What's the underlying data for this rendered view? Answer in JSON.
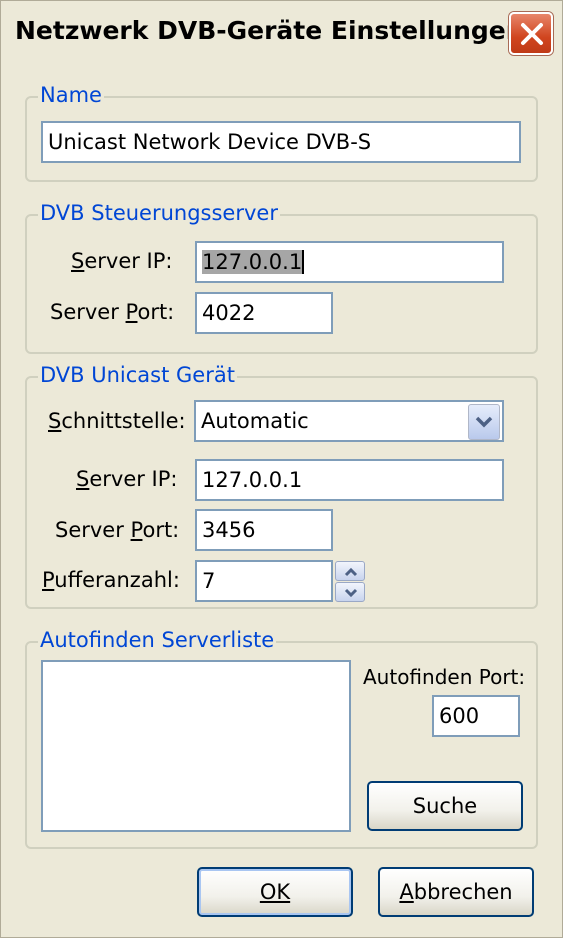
{
  "window": {
    "title": "Netzwerk DVB-Geräte Einstellungen"
  },
  "name_group": {
    "label": "Name",
    "value": "Unicast Network Device DVB-S"
  },
  "control_server": {
    "label": "DVB Steuerungsserver",
    "ip_label": "Server IP:",
    "ip_value": "127.0.0.1",
    "port_label": "Server Port:",
    "port_value": "4022"
  },
  "unicast_device": {
    "label": "DVB Unicast Gerät",
    "interface_label": "Schnittstelle:",
    "interface_value": "Automatic",
    "ip_label": "Server IP:",
    "ip_value": "127.0.0.1",
    "port_label": "Server Port:",
    "port_value": "3456",
    "buffer_label": "Pufferanzahl:",
    "buffer_value": "7"
  },
  "autofind": {
    "label": "Autofinden Serverliste",
    "port_label": "Autofinden Port:",
    "port_value": "600",
    "search_label": "Suche"
  },
  "buttons": {
    "ok": "OK",
    "cancel": "Abbrechen"
  },
  "icons": {
    "close": "close-icon",
    "dropdown": "chevron-down-icon",
    "spin_up": "arrow-up-icon",
    "spin_down": "arrow-down-icon"
  }
}
